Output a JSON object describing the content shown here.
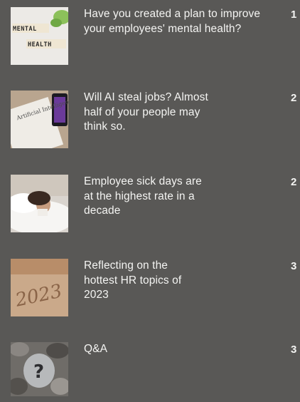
{
  "items": [
    {
      "title": "Have you created a plan to improve your employees' mental health?",
      "page": "1",
      "thumb_tiles_top": "MENTAL",
      "thumb_tiles_bottom": "HEALTH"
    },
    {
      "title": "Will AI steal jobs? Almost half of your people may think so.",
      "page": "2",
      "thumb_text": "Artificial Intelligence"
    },
    {
      "title": "Employee sick days are at the highest rate in a decade",
      "page": "2"
    },
    {
      "title": "Reflecting on the hottest HR topics of 2023",
      "page": "3",
      "thumb_text": "2023"
    },
    {
      "title": "Q&A",
      "page": "3",
      "thumb_text": "?"
    }
  ]
}
